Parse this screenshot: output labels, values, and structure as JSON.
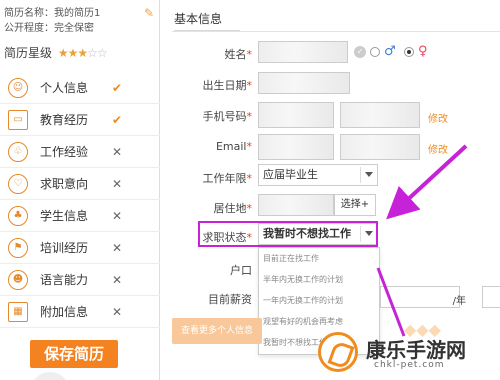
{
  "sidebar": {
    "resume_name": "简历名称：我的简历1",
    "visibility": "公开程度：完全保密",
    "rating_label": "简历星级",
    "rating_stars": 2.5,
    "rating_max": 5,
    "items": [
      {
        "label": "个人信息",
        "icon": "person-icon",
        "status": "✔"
      },
      {
        "label": "教育经历",
        "icon": "certificate-icon",
        "status": "✔"
      },
      {
        "label": "工作经验",
        "icon": "lungs-icon",
        "status": "✕"
      },
      {
        "label": "求职意向",
        "icon": "heart-hand-icon",
        "status": "✕"
      },
      {
        "label": "学生信息",
        "icon": "sprout-icon",
        "status": "✕"
      },
      {
        "label": "培训经历",
        "icon": "flag-icon",
        "status": "✕"
      },
      {
        "label": "语言能力",
        "icon": "smile-icon",
        "status": "✕"
      },
      {
        "label": "附加信息",
        "icon": "grid-icon",
        "status": "✕"
      }
    ],
    "save_label": "保存简历"
  },
  "main": {
    "section_title": "基本信息",
    "fields": {
      "name": {
        "label": "姓名"
      },
      "birthday": {
        "label": "出生日期"
      },
      "phone": {
        "label": "手机号码",
        "side": "修改"
      },
      "email": {
        "label": "Email",
        "side": "修改"
      },
      "work_years": {
        "label": "工作年限",
        "value": "应届毕业生"
      },
      "residence": {
        "label": "居住地",
        "button": "选择+"
      },
      "job_status": {
        "label": "求职状态",
        "value": "我暂时不想找工作"
      },
      "hukou": {
        "label": "户口"
      },
      "salary": {
        "label": "目前薪资",
        "unit": "/年"
      }
    },
    "job_status_options": [
      "目前正在找工作",
      "半年内无换工作的计划",
      "一年内无换工作的计划",
      "观望有好的机会再考虑",
      "我暂时不想找工作"
    ],
    "more_button": "查看更多个人信息"
  },
  "watermark": {
    "title": "康乐手游网",
    "subtitle": "chkl-pet.com"
  },
  "colors": {
    "accent": "#f58220",
    "highlight": "#c623d8"
  }
}
